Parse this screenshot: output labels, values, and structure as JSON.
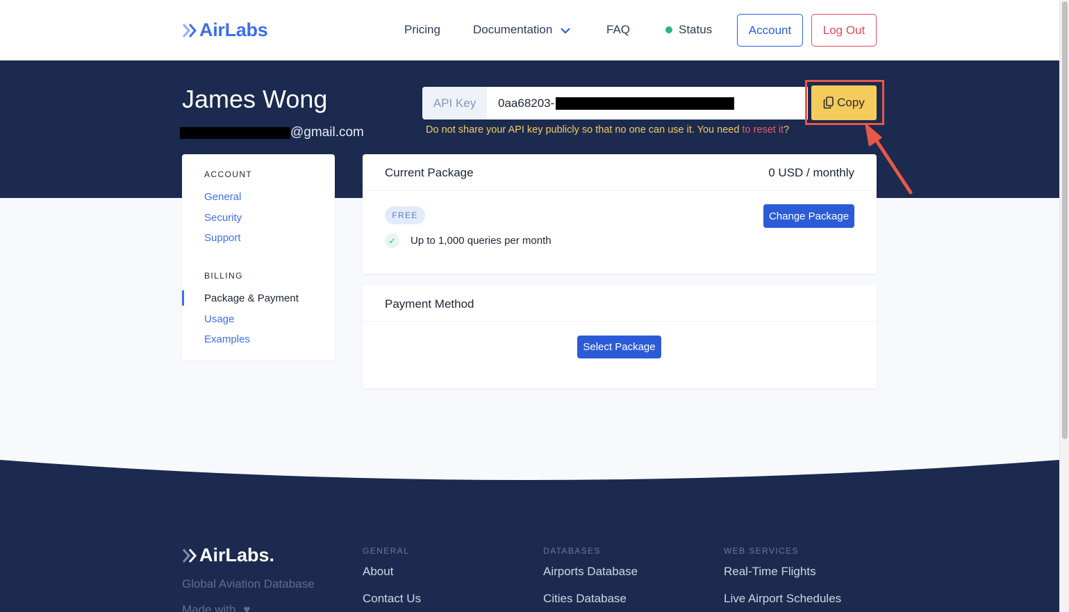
{
  "header": {
    "brand": "AirLabs",
    "nav": {
      "pricing": "Pricing",
      "documentation": "Documentation",
      "faq": "FAQ",
      "status": "Status"
    },
    "account_label": "Account",
    "logout_label": "Log Out",
    "status_color": "#2fb37a",
    "brand_color": "#3f6ee8"
  },
  "profile": {
    "name": "James Wong",
    "email_suffix": "@gmail.com"
  },
  "api_key": {
    "label": "API Key",
    "value_prefix": "0aa68203-",
    "copy_label": "Copy",
    "warning_text": "Do not share your API key publicly so that no one can use it. You need ",
    "reset_link": "to reset it",
    "warning_end": "?"
  },
  "sidebar": {
    "account_heading": "ACCOUNT",
    "account_items": [
      "General",
      "Security",
      "Support"
    ],
    "billing_heading": "BILLING",
    "billing_items": [
      "Package & Payment",
      "Usage",
      "Examples"
    ],
    "active_item": "Package & Payment"
  },
  "current_package": {
    "title": "Current Package",
    "price": "0 USD / monthly",
    "badge": "FREE",
    "feature": "Up to 1,000 queries per month",
    "change_button": "Change Package"
  },
  "payment_method": {
    "title": "Payment Method",
    "select_button": "Select Package"
  },
  "footer": {
    "brand": "AirLabs.",
    "tagline": "Global Aviation Database",
    "made_with": "Made with",
    "columns": [
      {
        "heading": "GENERAL",
        "links": [
          "About",
          "Contact Us"
        ]
      },
      {
        "heading": "DATABASES",
        "links": [
          "Airports Database",
          "Cities Database"
        ]
      },
      {
        "heading": "WEB SERVICES",
        "links": [
          "Real-Time Flights",
          "Live Airport Schedules"
        ]
      }
    ]
  },
  "colors": {
    "navy": "#1b2a4e",
    "primary": "#2b5bd7",
    "copy_button": "#f5cb5c",
    "logout": "#e04a5a",
    "annotation": "#e7574a"
  }
}
